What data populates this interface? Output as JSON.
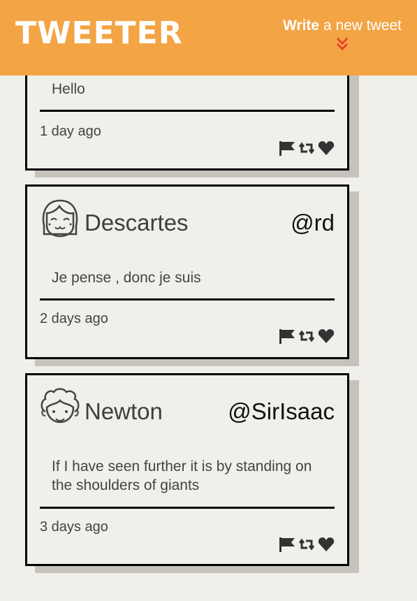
{
  "nav": {
    "brand": "TWEETER",
    "compose_bold": "Write",
    "compose_rest": " a new tweet"
  },
  "tweets": [
    {
      "content": "Hello",
      "time": "1 day ago"
    },
    {
      "name": "Descartes",
      "handle": "@rd",
      "content": "Je pense , donc je suis",
      "time": "2 days ago"
    },
    {
      "name": "Newton",
      "handle": "@SirIsaac",
      "content": "If I have seen further it is by standing on the shoulders of giants",
      "time": "3 days ago"
    }
  ],
  "colors": {
    "nav": "#f3a444",
    "page": "#f1efea",
    "chevron": "#e8432c",
    "shadow": "#c6c3bd"
  },
  "icons": [
    "flag-icon",
    "retweet-icon",
    "heart-icon"
  ]
}
